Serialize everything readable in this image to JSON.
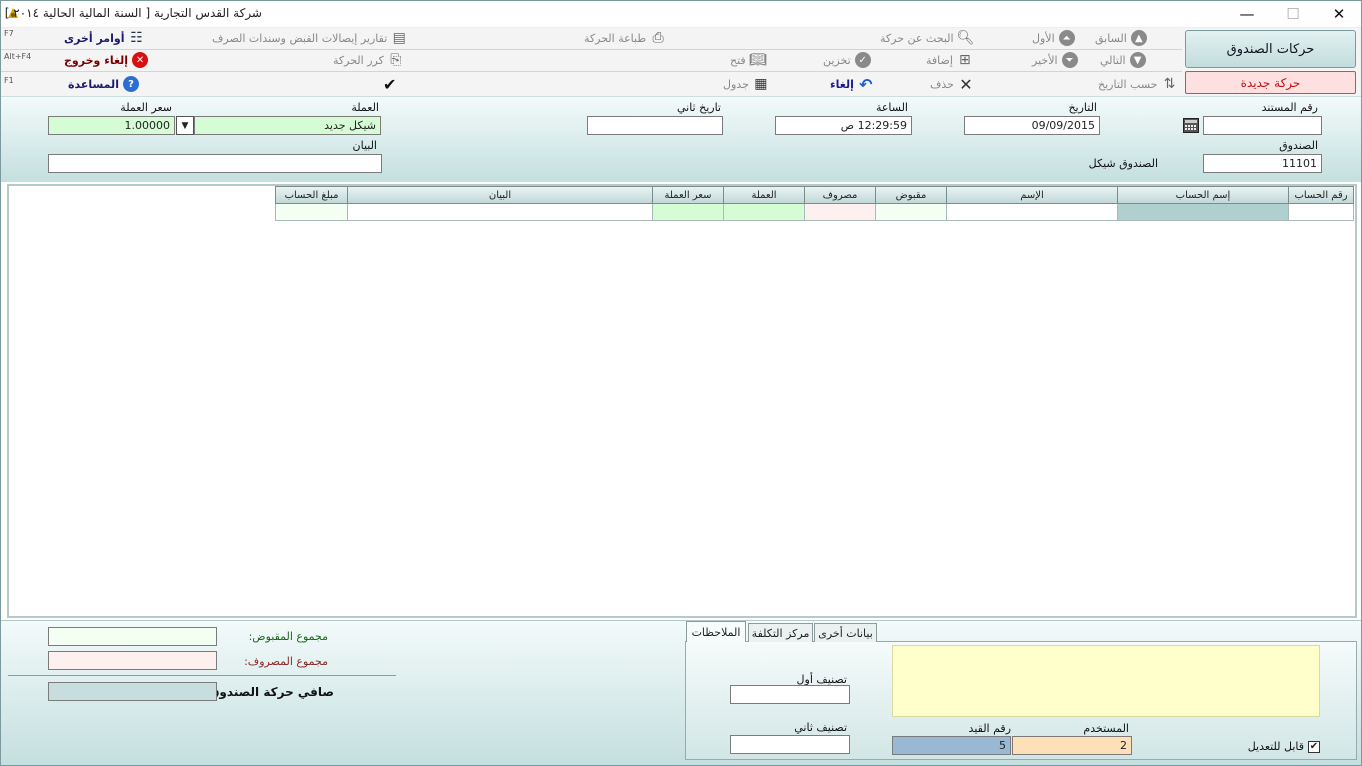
{
  "window": {
    "title": "شركة القدس التجارية  [ السنة المالية الحالية ٢٠١٤ ]",
    "minimize": "—",
    "maximize": "☐",
    "close": "✕"
  },
  "toolbar": {
    "row1": {
      "previous": "السابق",
      "first": "الأول",
      "search": "البحث عن حركة",
      "print": "طباعة الحركة",
      "reports": "تقارير إيصالات القبض وسندات الصرف",
      "other_commands": "أوامر أخرى",
      "other_shortcut": "F7"
    },
    "row2": {
      "next": "التالي",
      "last": "الأخير",
      "add": "إضافة",
      "save": "تخزين",
      "open": "فتح",
      "repeat": "كرر الحركة",
      "cancel_exit": "إلغاء وخروج",
      "cancel_exit_shortcut": "Alt+F4"
    },
    "row3": {
      "by_date": "حسب التاريخ",
      "delete": "حذف",
      "cancel": "إلغاء",
      "table": "جدول",
      "confirm": "✔",
      "help": "المساعدة",
      "help_shortcut": "F1"
    },
    "box_moves": "حركات الصندوق",
    "new_move": "حركة جديدة"
  },
  "header": {
    "doc_no_label": "رقم المستند",
    "doc_no_value": "",
    "date_label": "التاريخ",
    "date_value": "09/09/2015",
    "time_label": "الساعة",
    "time_value": "12:29:59 ص",
    "date2_label": "تاريخ ثاني",
    "date2_value": "",
    "currency_label": "العملة",
    "currency_value": "شيكل جديد",
    "rate_label": "سعر العملة",
    "rate_value": "1.00000",
    "box_label": "الصندوق",
    "box_value": "11101",
    "box_name": "الصندوق شيكل",
    "desc_label": "البيان",
    "desc_value": ""
  },
  "grid": {
    "columns": [
      "رقم الحساب",
      "إسم الحساب",
      "الإسم",
      "مقبوض",
      "مصروف",
      "العملة",
      "سعر العملة",
      "البيان",
      "مبلغ الحساب"
    ]
  },
  "footer": {
    "total_received_label": "مجموع المقبوض:",
    "total_received_value": "",
    "total_spent_label": "مجموع المصروف:",
    "total_spent_value": "",
    "net_label": "صافي حركة الصندوق:",
    "net_value": ""
  },
  "tabs": {
    "notes": "الملاحظات",
    "cost_center": "مركز التكلفة",
    "other_data": "بيانات أخرى",
    "class1_label": "تصنيف أول",
    "class1_value": "",
    "class2_label": "تصنيف ثاني",
    "class2_value": "",
    "user_label": "المستخدم",
    "user_value": "2",
    "entry_label": "رقم القيد",
    "entry_value": "5",
    "editable_label": "قابل للتعديل",
    "editable_checked": "✔"
  }
}
